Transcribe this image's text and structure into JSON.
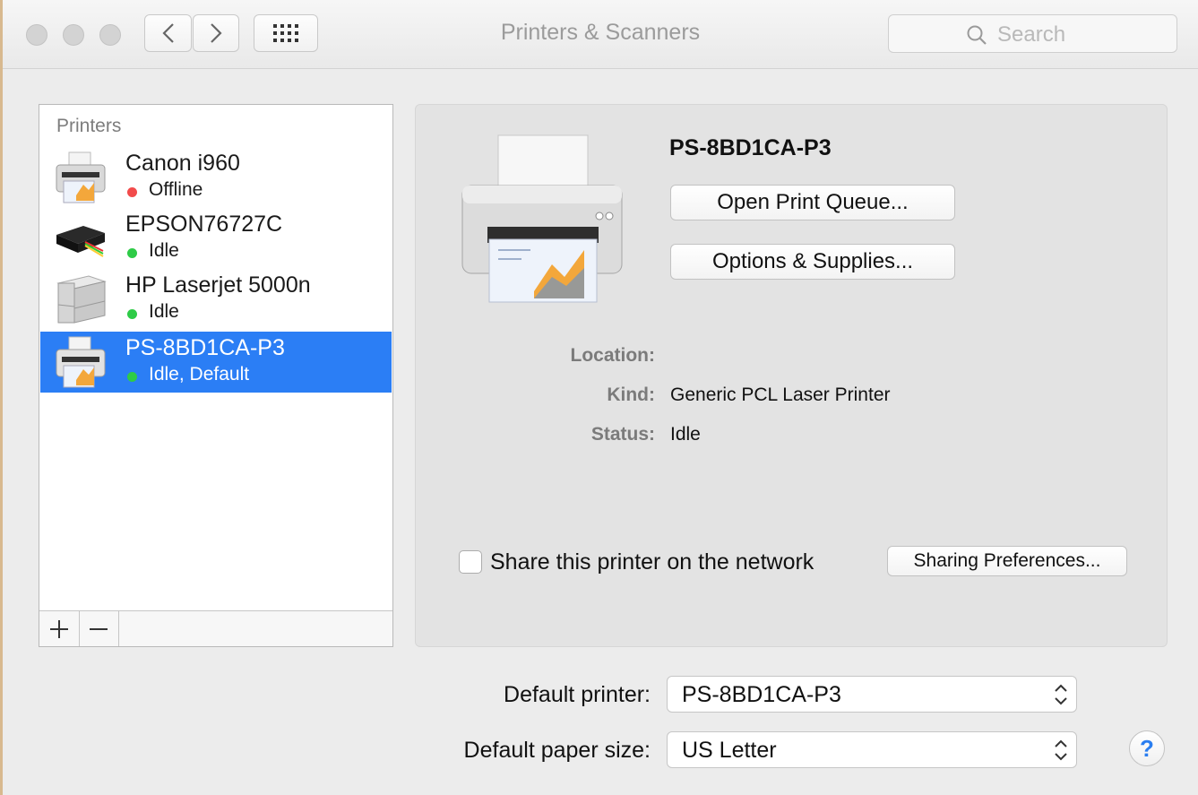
{
  "window": {
    "title": "Printers & Scanners"
  },
  "search": {
    "placeholder": "Search"
  },
  "printers": {
    "header": "Printers",
    "items": [
      {
        "name": "Canon i960",
        "status": "Offline",
        "status_color": "#f24b4b"
      },
      {
        "name": "EPSON76727C",
        "status": "Idle",
        "status_color": "#2ecb47"
      },
      {
        "name": "HP Laserjet 5000n",
        "status": "Idle",
        "status_color": "#2ecb47"
      },
      {
        "name": "PS-8BD1CA-P3",
        "status": "Idle, Default",
        "status_color": "#2ecb47",
        "selected": true
      }
    ],
    "add_label": "+",
    "remove_label": "—"
  },
  "detail": {
    "printer_name": "PS-8BD1CA-P3",
    "open_queue_label": "Open Print Queue...",
    "options_label": "Options & Supplies...",
    "location_label": "Location:",
    "location_value": "",
    "kind_label": "Kind:",
    "kind_value": "Generic PCL Laser Printer",
    "status_label": "Status:",
    "status_value": "Idle",
    "share_label": "Share this printer on the network",
    "share_checked": false,
    "sharing_prefs_label": "Sharing Preferences..."
  },
  "defaults": {
    "printer_label": "Default printer:",
    "printer_value": "PS-8BD1CA-P3",
    "paper_label": "Default paper size:",
    "paper_value": "US Letter"
  },
  "help": {
    "label": "?"
  },
  "colors": {
    "selection": "#2b7ef5",
    "accent": "#2a7ef0"
  }
}
